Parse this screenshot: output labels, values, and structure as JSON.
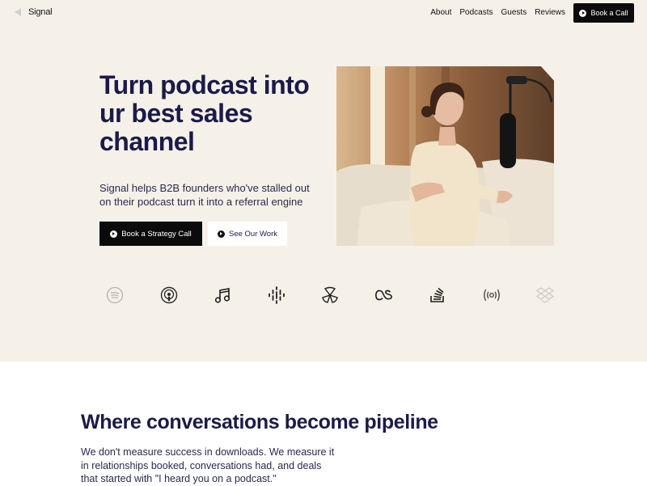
{
  "nav": {
    "brand": "Signal",
    "links": [
      "About",
      "Podcasts",
      "Guests",
      "Reviews"
    ],
    "cta_label": "Book a Call"
  },
  "hero": {
    "headline": "Turn podcast into ur best sales channel",
    "subtext": "Signal helps B2B founders who've stalled out on their podcast turn it into a referral engine",
    "primary_cta": "Book a Strategy Call",
    "secondary_cta": "See Our Work",
    "background_color": "#f6f1e8"
  },
  "platform_icons": [
    "spotify-icon",
    "podcasts-icon",
    "music-icon",
    "google-podcasts-icon",
    "overcast-icon",
    "lastfm-icon",
    "stack-icon",
    "broadcast-icon",
    "dropbox-icon"
  ],
  "section": {
    "title": "Where conversations become pipeline",
    "body": "We don't measure success in downloads. We measure it in relationships booked, conversations had, and deals that started with \"I heard you on a podcast.\""
  },
  "colors": {
    "navy": "#1b1a4a",
    "black": "#0b0b0b",
    "cream": "#f6f1e8"
  }
}
